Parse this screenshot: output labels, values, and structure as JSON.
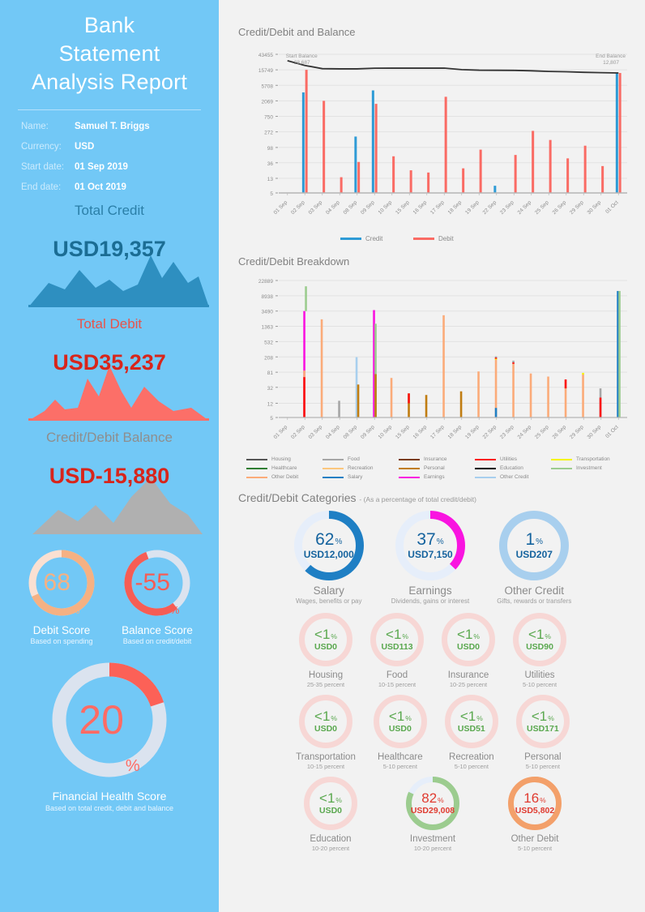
{
  "report": {
    "title_lines": [
      "Bank",
      "Statement",
      "Analysis Report"
    ],
    "meta": [
      {
        "label": "Name:",
        "value": "Samuel T. Briggs"
      },
      {
        "label": "Currency:",
        "value": "USD"
      },
      {
        "label": "Start date:",
        "value": "01 Sep 2019"
      },
      {
        "label": "End date:",
        "value": "01 Oct 2019"
      }
    ],
    "totals": [
      {
        "label": "Total Credit",
        "value": "USD19,357",
        "color": "#1b6d94"
      },
      {
        "label": "Total Debit",
        "value": "USD35,237",
        "color": "#d8251b"
      },
      {
        "label": "Credit/Debit Balance",
        "value": "USD-15,880",
        "color": "#d8251b"
      }
    ],
    "scores": [
      {
        "num": "68",
        "pct": "%",
        "title": "Debit Score",
        "sub": "Based on spending",
        "value": 68,
        "color": "#f5b183"
      },
      {
        "num": "-55",
        "pct": "%",
        "title": "Balance Score",
        "sub": "Based on credit/debit",
        "value": 55,
        "color": "#f65d55"
      }
    ],
    "health": {
      "num": "20",
      "pct": "%",
      "title": "Financial Health Score",
      "sub": "Based on total credit, debit and balance",
      "value": 20,
      "color": "#fc6157"
    }
  },
  "chart_data": [
    {
      "type": "bar",
      "title": "Credit/Debit and Balance",
      "xlabel": "",
      "ylabel": "",
      "yscale": "log",
      "yticks": [
        5,
        13,
        36,
        98,
        272,
        750,
        2069,
        5708,
        15749,
        43455
      ],
      "ytick_labels": [
        "5",
        "13",
        "36",
        "98",
        "272",
        "750",
        "2069",
        "5708",
        "15749",
        "43455"
      ],
      "categories": [
        "01 Sep",
        "02 Sep",
        "03 Sep",
        "04 Sep",
        "08 Sep",
        "09 Sep",
        "10 Sep",
        "15 Sep",
        "16 Sep",
        "17 Sep",
        "18 Sep",
        "19 Sep",
        "22 Sep",
        "23 Sep",
        "24 Sep",
        "25 Sep",
        "26 Sep",
        "29 Sep",
        "30 Sep",
        "01 Oct"
      ],
      "series": [
        {
          "name": "Credit",
          "color": "#2e9bd6",
          "values": [
            0,
            3600,
            0,
            0,
            200,
            4100,
            0,
            0,
            0,
            0,
            0,
            0,
            8,
            0,
            0,
            0,
            0,
            0,
            0,
            12807
          ]
        },
        {
          "name": "Debit",
          "color": "#fa6b64",
          "values": [
            0,
            15749,
            2069,
            14,
            38,
            1700,
            55,
            22,
            19,
            2700,
            25,
            85,
            0,
            60,
            290,
            160,
            48,
            110,
            29,
            12807
          ]
        }
      ],
      "balance_line": {
        "name": "Balance",
        "color": "#333333",
        "values": [
          28687,
          21000,
          17000,
          16800,
          16800,
          17500,
          17600,
          17600,
          17600,
          17600,
          16000,
          15400,
          15300,
          15200,
          14800,
          14200,
          13900,
          13400,
          13100,
          12807
        ]
      },
      "annotations": [
        {
          "text": "Start Balance",
          "value": "28,687",
          "position": "left"
        },
        {
          "text": "End Balance",
          "value": "12,807",
          "position": "right"
        }
      ],
      "legend": [
        {
          "label": "Credit",
          "color": "#2e9bd6"
        },
        {
          "label": "Debit",
          "color": "#fa6b64"
        }
      ]
    },
    {
      "type": "bar",
      "title": "Credit/Debit Breakdown",
      "yscale": "log",
      "yticks": [
        5,
        12,
        32,
        81,
        208,
        532,
        1363,
        3490,
        8938,
        22889
      ],
      "ytick_labels": [
        "5",
        "12",
        "32",
        "81",
        "208",
        "532",
        "1363",
        "3490",
        "8938",
        "22889"
      ],
      "categories": [
        "01 Sep",
        "02 Sep",
        "03 Sep",
        "04 Sep",
        "08 Sep",
        "09 Sep",
        "10 Sep",
        "15 Sep",
        "16 Sep",
        "17 Sep",
        "18 Sep",
        "19 Sep",
        "22 Sep",
        "23 Sep",
        "24 Sep",
        "25 Sep",
        "26 Sep",
        "29 Sep",
        "30 Sep",
        "01 Oct"
      ],
      "legend": [
        {
          "label": "Housing",
          "color": "#555555"
        },
        {
          "label": "Food",
          "color": "#a6a6a6"
        },
        {
          "label": "Insurance",
          "color": "#7a3b10"
        },
        {
          "label": "Utilities",
          "color": "#fa1414"
        },
        {
          "label": "Transportation",
          "color": "#f5f500"
        },
        {
          "label": "Healthcare",
          "color": "#2e7d32"
        },
        {
          "label": "Recreation",
          "color": "#fbc77d"
        },
        {
          "label": "Personal",
          "color": "#c07c10"
        },
        {
          "label": "Education",
          "color": "#000000"
        },
        {
          "label": "Investment",
          "color": "#9ccc8f"
        },
        {
          "label": "Other Debit",
          "color": "#fbab79"
        },
        {
          "label": "Salary",
          "color": "#1f7fc4"
        },
        {
          "label": "Earnings",
          "color": "#f914e0"
        },
        {
          "label": "Other Credit",
          "color": "#a8cfee"
        }
      ]
    }
  ],
  "categories_section": {
    "title": "Credit/Debit Categories",
    "subtitle": "- (As a percentage of total credit/debit)",
    "credit": [
      {
        "pct": "62",
        "pctsym": "%",
        "amount": "USD12,000",
        "name": "Salary",
        "sub": "Wages, benefits or pay",
        "value": 62,
        "ring": "#1f7fc4",
        "text": "#15639e"
      },
      {
        "pct": "37",
        "pctsym": "%",
        "amount": "USD7,150",
        "name": "Earnings",
        "sub": "Dividends, gains or interest",
        "value": 37,
        "ring": "#f914e0",
        "text": "#15639e"
      },
      {
        "pct": "1",
        "pctsym": "%",
        "amount": "USD207",
        "name": "Other Credit",
        "sub": "Gifts, rewards or transfers",
        "value": 1,
        "ring": "#a8cfee",
        "text": "#15639e"
      }
    ],
    "debit_rows": [
      [
        {
          "pct": "<1",
          "pctsym": "%",
          "amount": "USD0",
          "name": "Housing",
          "sub": "25-35 percent",
          "value": 0,
          "ring": "#f7d7d5",
          "text": "#5aa84f"
        },
        {
          "pct": "<1",
          "pctsym": "%",
          "amount": "USD113",
          "name": "Food",
          "sub": "10-15 percent",
          "value": 0.5,
          "ring": "#f7d7d5",
          "text": "#5aa84f"
        },
        {
          "pct": "<1",
          "pctsym": "%",
          "amount": "USD0",
          "name": "Insurance",
          "sub": "10-25 percent",
          "value": 0,
          "ring": "#f7d7d5",
          "text": "#5aa84f"
        },
        {
          "pct": "<1",
          "pctsym": "%",
          "amount": "USD90",
          "name": "Utilities",
          "sub": "5-10 percent",
          "value": 0.4,
          "ring": "#f7d7d5",
          "text": "#5aa84f"
        }
      ],
      [
        {
          "pct": "<1",
          "pctsym": "%",
          "amount": "USD0",
          "name": "Transportation",
          "sub": "10-15 percent",
          "value": 0,
          "ring": "#f7d7d5",
          "text": "#5aa84f"
        },
        {
          "pct": "<1",
          "pctsym": "%",
          "amount": "USD0",
          "name": "Healthcare",
          "sub": "5-10 percent",
          "value": 0,
          "ring": "#f7d7d5",
          "text": "#5aa84f"
        },
        {
          "pct": "<1",
          "pctsym": "%",
          "amount": "USD51",
          "name": "Recreation",
          "sub": "5-10 percent",
          "value": 0.2,
          "ring": "#f7d7d5",
          "text": "#5aa84f"
        },
        {
          "pct": "<1",
          "pctsym": "%",
          "amount": "USD171",
          "name": "Personal",
          "sub": "5-10 percent",
          "value": 0.7,
          "ring": "#f7d7d5",
          "text": "#5aa84f"
        }
      ],
      [
        {
          "pct": "<1",
          "pctsym": "%",
          "amount": "USD0",
          "name": "Education",
          "sub": "10-20 percent",
          "value": 0,
          "ring": "#f7d7d5",
          "text": "#5aa84f"
        },
        {
          "pct": "82",
          "pctsym": "%",
          "amount": "USD29,008",
          "name": "Investment",
          "sub": "10-20 percent",
          "value": 82,
          "ring": "#9ccc8f",
          "text": "#e03b30"
        },
        {
          "pct": "16",
          "pctsym": "%",
          "amount": "USD5,802",
          "name": "Other Debit",
          "sub": "5-10 percent",
          "value": 16,
          "ring": "#f3a06a",
          "text": "#e03b30"
        }
      ]
    ]
  }
}
